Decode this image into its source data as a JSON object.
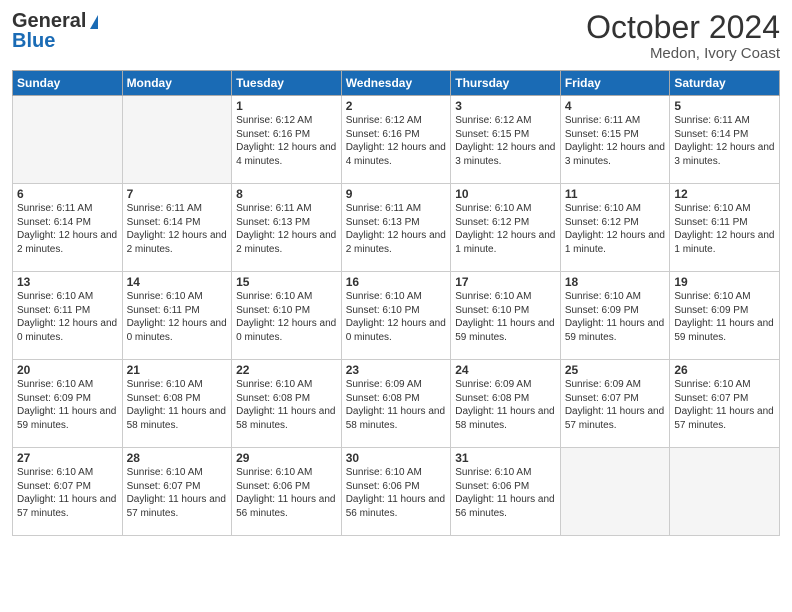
{
  "logo": {
    "general": "General",
    "blue": "Blue"
  },
  "title": "October 2024",
  "subtitle": "Medon, Ivory Coast",
  "weekdays": [
    "Sunday",
    "Monday",
    "Tuesday",
    "Wednesday",
    "Thursday",
    "Friday",
    "Saturday"
  ],
  "weeks": [
    [
      {
        "day": "",
        "info": ""
      },
      {
        "day": "",
        "info": ""
      },
      {
        "day": "1",
        "info": "Sunrise: 6:12 AM\nSunset: 6:16 PM\nDaylight: 12 hours and 4 minutes."
      },
      {
        "day": "2",
        "info": "Sunrise: 6:12 AM\nSunset: 6:16 PM\nDaylight: 12 hours and 4 minutes."
      },
      {
        "day": "3",
        "info": "Sunrise: 6:12 AM\nSunset: 6:15 PM\nDaylight: 12 hours and 3 minutes."
      },
      {
        "day": "4",
        "info": "Sunrise: 6:11 AM\nSunset: 6:15 PM\nDaylight: 12 hours and 3 minutes."
      },
      {
        "day": "5",
        "info": "Sunrise: 6:11 AM\nSunset: 6:14 PM\nDaylight: 12 hours and 3 minutes."
      }
    ],
    [
      {
        "day": "6",
        "info": "Sunrise: 6:11 AM\nSunset: 6:14 PM\nDaylight: 12 hours and 2 minutes."
      },
      {
        "day": "7",
        "info": "Sunrise: 6:11 AM\nSunset: 6:14 PM\nDaylight: 12 hours and 2 minutes."
      },
      {
        "day": "8",
        "info": "Sunrise: 6:11 AM\nSunset: 6:13 PM\nDaylight: 12 hours and 2 minutes."
      },
      {
        "day": "9",
        "info": "Sunrise: 6:11 AM\nSunset: 6:13 PM\nDaylight: 12 hours and 2 minutes."
      },
      {
        "day": "10",
        "info": "Sunrise: 6:10 AM\nSunset: 6:12 PM\nDaylight: 12 hours and 1 minute."
      },
      {
        "day": "11",
        "info": "Sunrise: 6:10 AM\nSunset: 6:12 PM\nDaylight: 12 hours and 1 minute."
      },
      {
        "day": "12",
        "info": "Sunrise: 6:10 AM\nSunset: 6:11 PM\nDaylight: 12 hours and 1 minute."
      }
    ],
    [
      {
        "day": "13",
        "info": "Sunrise: 6:10 AM\nSunset: 6:11 PM\nDaylight: 12 hours and 0 minutes."
      },
      {
        "day": "14",
        "info": "Sunrise: 6:10 AM\nSunset: 6:11 PM\nDaylight: 12 hours and 0 minutes."
      },
      {
        "day": "15",
        "info": "Sunrise: 6:10 AM\nSunset: 6:10 PM\nDaylight: 12 hours and 0 minutes."
      },
      {
        "day": "16",
        "info": "Sunrise: 6:10 AM\nSunset: 6:10 PM\nDaylight: 12 hours and 0 minutes."
      },
      {
        "day": "17",
        "info": "Sunrise: 6:10 AM\nSunset: 6:10 PM\nDaylight: 11 hours and 59 minutes."
      },
      {
        "day": "18",
        "info": "Sunrise: 6:10 AM\nSunset: 6:09 PM\nDaylight: 11 hours and 59 minutes."
      },
      {
        "day": "19",
        "info": "Sunrise: 6:10 AM\nSunset: 6:09 PM\nDaylight: 11 hours and 59 minutes."
      }
    ],
    [
      {
        "day": "20",
        "info": "Sunrise: 6:10 AM\nSunset: 6:09 PM\nDaylight: 11 hours and 59 minutes."
      },
      {
        "day": "21",
        "info": "Sunrise: 6:10 AM\nSunset: 6:08 PM\nDaylight: 11 hours and 58 minutes."
      },
      {
        "day": "22",
        "info": "Sunrise: 6:10 AM\nSunset: 6:08 PM\nDaylight: 11 hours and 58 minutes."
      },
      {
        "day": "23",
        "info": "Sunrise: 6:09 AM\nSunset: 6:08 PM\nDaylight: 11 hours and 58 minutes."
      },
      {
        "day": "24",
        "info": "Sunrise: 6:09 AM\nSunset: 6:08 PM\nDaylight: 11 hours and 58 minutes."
      },
      {
        "day": "25",
        "info": "Sunrise: 6:09 AM\nSunset: 6:07 PM\nDaylight: 11 hours and 57 minutes."
      },
      {
        "day": "26",
        "info": "Sunrise: 6:10 AM\nSunset: 6:07 PM\nDaylight: 11 hours and 57 minutes."
      }
    ],
    [
      {
        "day": "27",
        "info": "Sunrise: 6:10 AM\nSunset: 6:07 PM\nDaylight: 11 hours and 57 minutes."
      },
      {
        "day": "28",
        "info": "Sunrise: 6:10 AM\nSunset: 6:07 PM\nDaylight: 11 hours and 57 minutes."
      },
      {
        "day": "29",
        "info": "Sunrise: 6:10 AM\nSunset: 6:06 PM\nDaylight: 11 hours and 56 minutes."
      },
      {
        "day": "30",
        "info": "Sunrise: 6:10 AM\nSunset: 6:06 PM\nDaylight: 11 hours and 56 minutes."
      },
      {
        "day": "31",
        "info": "Sunrise: 6:10 AM\nSunset: 6:06 PM\nDaylight: 11 hours and 56 minutes."
      },
      {
        "day": "",
        "info": ""
      },
      {
        "day": "",
        "info": ""
      }
    ]
  ]
}
